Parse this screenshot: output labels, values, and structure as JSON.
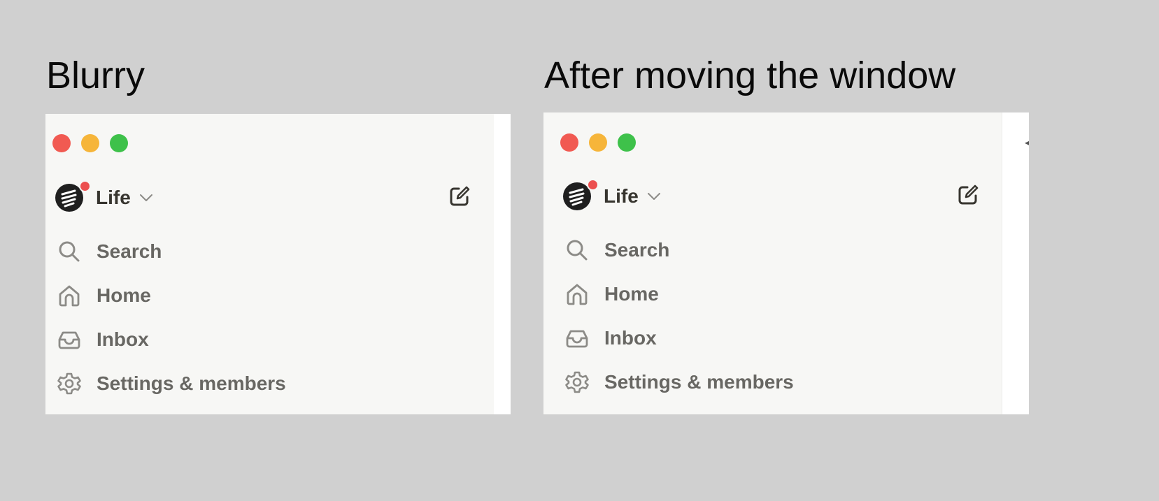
{
  "captions": {
    "left": "Blurry",
    "right": "After moving the window"
  },
  "colors": {
    "background": "#d0d0d0",
    "sidebar": "#f7f7f5",
    "close": "#f15a52",
    "minimize": "#f6b53a",
    "maximize": "#3ec14a",
    "notification_dot": "#ec4f4f",
    "text_primary": "#37352f",
    "text_secondary": "#686763"
  },
  "left_panel": {
    "workspace": {
      "name": "Life",
      "icon": "workspace-logo-icon"
    },
    "nav": [
      {
        "label": "Search",
        "icon": "search-icon"
      },
      {
        "label": "Home",
        "icon": "home-icon"
      },
      {
        "label": "Inbox",
        "icon": "inbox-icon"
      },
      {
        "label": "Settings & members",
        "icon": "gear-icon"
      }
    ]
  },
  "right_panel": {
    "workspace": {
      "name": "Life",
      "icon": "workspace-logo-icon"
    },
    "nav": [
      {
        "label": "Search",
        "icon": "search-icon"
      },
      {
        "label": "Home",
        "icon": "home-icon"
      },
      {
        "label": "Inbox",
        "icon": "inbox-icon"
      },
      {
        "label": "Settings & members",
        "icon": "gear-icon"
      }
    ]
  }
}
